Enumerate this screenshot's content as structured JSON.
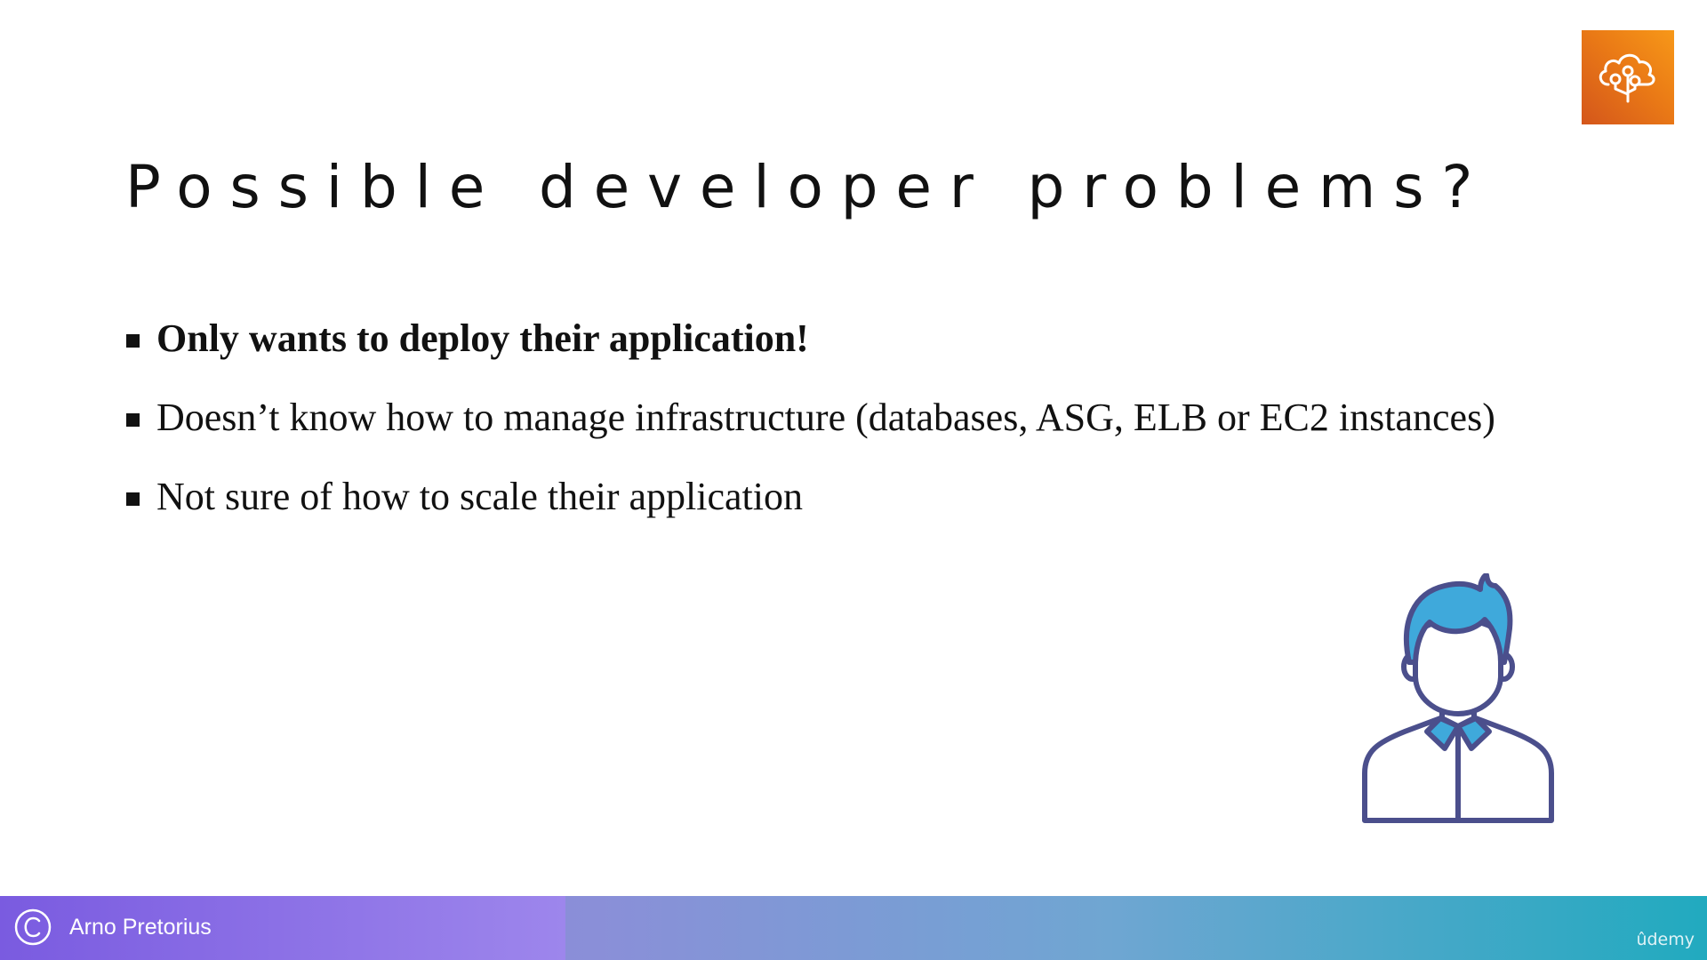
{
  "slide": {
    "title": "Possible developer problems?",
    "bullets": [
      {
        "text": "Only wants to deploy their application!",
        "bold": true
      },
      {
        "text": "Doesn’t know how to manage infrastructure (databases, ASG, ELB or EC2 instances)",
        "bold": false
      },
      {
        "text": "Not sure of how to scale their application",
        "bold": false
      }
    ],
    "service_icon": "aws-elastic-beanstalk-cloud-icon",
    "illustration": "developer-person-icon"
  },
  "footer": {
    "author": "Arno Pretorius",
    "copyright_icon": "copyright-icon",
    "watermark": "ûdemy"
  },
  "colors": {
    "aws_orange_dark": "#d4561b",
    "aws_orange_light": "#f79818",
    "person_outline": "#4b4f8c",
    "person_fill": "#3fa9db",
    "footer_purple": "#7a5be0",
    "footer_teal": "#21aabf",
    "text": "#111111"
  }
}
